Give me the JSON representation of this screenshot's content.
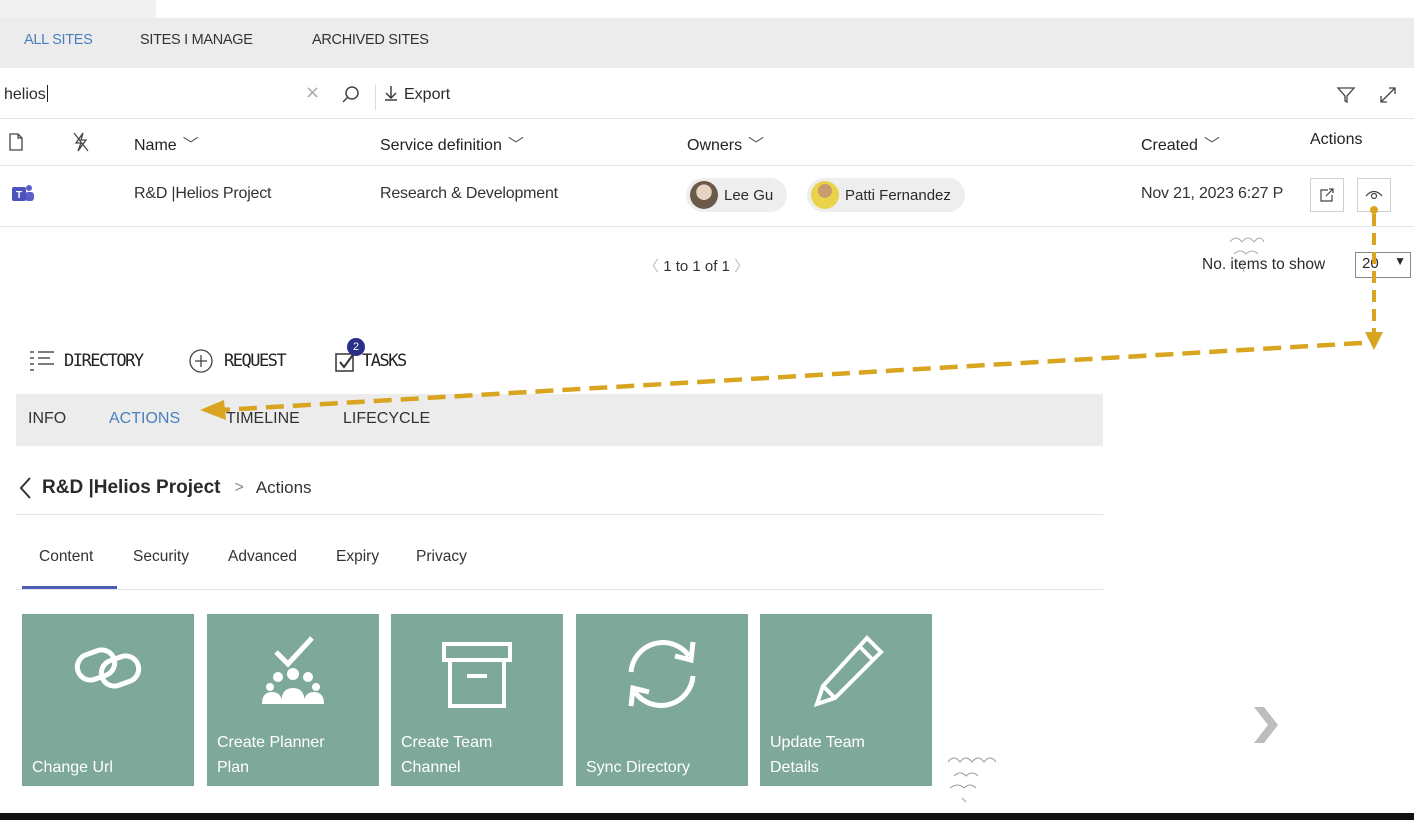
{
  "site_tabs": [
    "ALL SITES",
    "SITES I MANAGE",
    "ARCHIVED SITES"
  ],
  "search": {
    "value": "helios",
    "export_label": "Export"
  },
  "columns": {
    "name": "Name",
    "service": "Service definition",
    "owners": "Owners",
    "created": "Created",
    "actions": "Actions"
  },
  "row": {
    "name": "R&D |Helios Project",
    "service": "Research & Development",
    "owners": [
      "Lee Gu",
      "Patti Fernandez"
    ],
    "created": "Nov 21, 2023 6:27 P"
  },
  "pager": {
    "text": "1 to 1 of 1",
    "items_label": "No. items to show",
    "items_value": "20"
  },
  "nav": {
    "directory": "DIRECTORY",
    "request": "REQUEST",
    "tasks": "TASKS",
    "tasks_badge": "2"
  },
  "info_tabs": [
    "INFO",
    "ACTIONS",
    "TIMELINE",
    "LIFECYCLE"
  ],
  "breadcrumb": {
    "title": "R&D |Helios Project",
    "current": "Actions"
  },
  "sub_tabs": [
    "Content",
    "Security",
    "Advanced",
    "Expiry",
    "Privacy"
  ],
  "tiles": [
    {
      "label": "Change Url",
      "icon": "link-icon"
    },
    {
      "label": "Create Planner\nPlan",
      "icon": "planner-icon"
    },
    {
      "label": "Create Team\nChannel",
      "icon": "archive-box-icon"
    },
    {
      "label": "Sync Directory",
      "icon": "sync-icon"
    },
    {
      "label": "Update Team\nDetails",
      "icon": "pencil-icon"
    }
  ],
  "colors": {
    "accent": "#4a7fbd",
    "tile": "#7ea89a",
    "annotation_arrow": "#d9a521",
    "badge": "#2a2f8a"
  }
}
